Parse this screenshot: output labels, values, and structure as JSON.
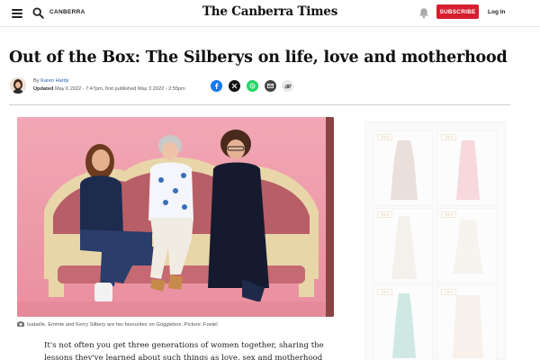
{
  "header": {
    "menu_icon": "hamburger-menu-icon",
    "search_icon": "search-icon",
    "section_label": "CANBERRA",
    "masthead": "The Canberra Times",
    "bell_icon": "bell-icon",
    "subscribe_label": "SUBSCRIBE",
    "login_label": "Log In",
    "colors": {
      "subscribe_bg": "#d51f2e"
    }
  },
  "article": {
    "headline": "Out of the Box: The Silberys on life, love and motherhood",
    "byline": {
      "prefix": "By",
      "author": "Karen Hardy",
      "updated_label": "Updated",
      "updated_text": "May 6 2022 - 7:47pm, first published May 3 2022 - 2:55pm"
    },
    "share_buttons": [
      {
        "name": "facebook",
        "icon": "facebook-icon",
        "color": "#1877f2",
        "glyph": "f"
      },
      {
        "name": "x",
        "icon": "x-icon",
        "color": "#111111",
        "glyph": "𝕏"
      },
      {
        "name": "whatsapp",
        "icon": "whatsapp-icon",
        "color": "#25d366",
        "glyph": "✆"
      },
      {
        "name": "email",
        "icon": "email-icon",
        "color": "#444444",
        "glyph": "✉"
      },
      {
        "name": "copy-link",
        "icon": "link-icon",
        "color": "#e8e8e8",
        "glyph": "🔗"
      }
    ],
    "caption": "Isabelle, Emmie and Kerry Silbery are fan favourites on Gogglebox. Picture: Foxtel",
    "body_first_line": "It's not often you get three generations of women together, sharing the",
    "body_second_line": "lessons they've learned about such things as love, sex and motherhood"
  },
  "ad": {
    "badges": [
      "-15%",
      "-15%",
      "-15%",
      "-15%",
      "-15%",
      "-15%"
    ]
  }
}
